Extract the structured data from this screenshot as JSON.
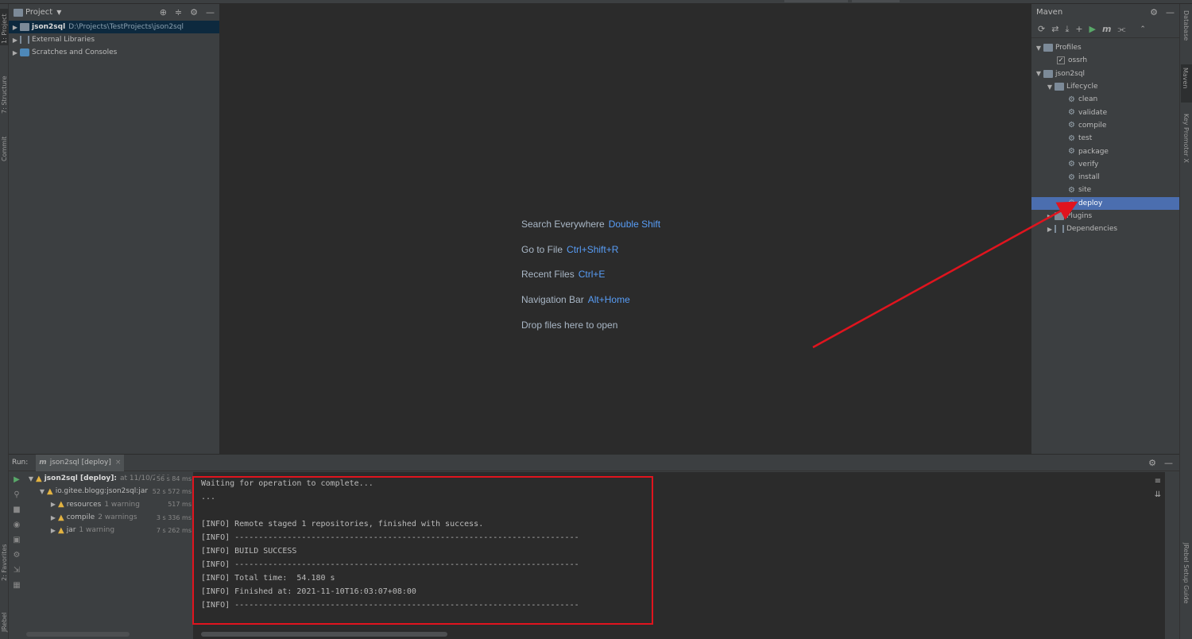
{
  "project": {
    "title": "Project",
    "tree": [
      {
        "name": "json2sql",
        "path": "D:\\Projects\\TestProjects\\json2sql"
      },
      {
        "name": "External Libraries"
      },
      {
        "name": "Scratches and Consoles"
      }
    ]
  },
  "left_tabs": [
    "1: Project",
    "7: Structure",
    "Commit",
    "2: Favorites",
    "JRebel"
  ],
  "right_tabs": [
    "Database",
    "Maven",
    "Key Promoter X",
    "JRebel Setup Guide"
  ],
  "editor_hints": [
    {
      "label": "Search Everywhere",
      "key": "Double Shift"
    },
    {
      "label": "Go to File",
      "key": "Ctrl+Shift+R"
    },
    {
      "label": "Recent Files",
      "key": "Ctrl+E"
    },
    {
      "label": "Navigation Bar",
      "key": "Alt+Home"
    },
    {
      "label": "Drop files here to open",
      "key": ""
    }
  ],
  "maven": {
    "title": "Maven",
    "profiles_label": "Profiles",
    "profile": "ossrh",
    "project": "json2sql",
    "lifecycle_label": "Lifecycle",
    "goals": [
      "clean",
      "validate",
      "compile",
      "test",
      "package",
      "verify",
      "install",
      "site",
      "deploy"
    ],
    "selected_goal": "deploy",
    "plugins_label": "Plugins",
    "dependencies_label": "Dependencies"
  },
  "run": {
    "label": "Run:",
    "tab": "json2sql [deploy]",
    "tree": [
      {
        "name": "json2sql [deploy]:",
        "detail": "at 11/10/2021",
        "time": "56 s 84 ms"
      },
      {
        "name": "io.gitee.blogg:json2sql:jar",
        "detail": "",
        "time": "52 s 572 ms"
      },
      {
        "name": "resources",
        "detail": "1 warning",
        "time": "517 ms"
      },
      {
        "name": "compile",
        "detail": "2 warnings",
        "time": "3 s 336 ms"
      },
      {
        "name": "jar",
        "detail": "1 warning",
        "time": "7 s 262 ms"
      }
    ],
    "console": [
      "Waiting for operation to complete...",
      "...",
      "",
      "[INFO] Remote staged 1 repositories, finished with success.",
      "[INFO] ------------------------------------------------------------------------",
      "[INFO] BUILD SUCCESS",
      "[INFO] ------------------------------------------------------------------------",
      "[INFO] Total time:  54.180 s",
      "[INFO] Finished at: 2021-11-10T16:03:07+08:00",
      "[INFO] ------------------------------------------------------------------------"
    ]
  },
  "colors": {
    "annotation_red": "#e0141e",
    "selection_blue": "#4b6eaf",
    "key_blue": "#589df6",
    "warning": "#e3b341"
  }
}
